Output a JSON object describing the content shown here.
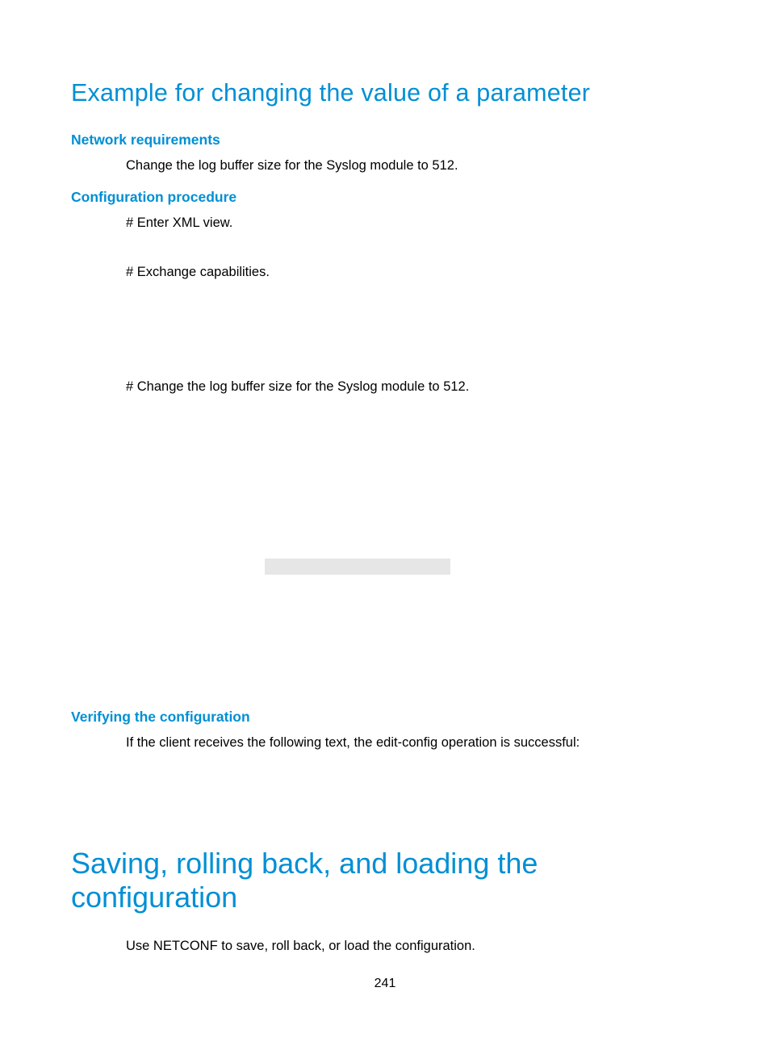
{
  "page_number": "241",
  "section1": {
    "title": "Example for changing the value of a parameter",
    "sub1": {
      "heading": "Network requirements",
      "text": "Change the log buffer size for the Syslog module to 512."
    },
    "sub2": {
      "heading": "Configuration procedure",
      "step1": "# Enter XML view.",
      "step2": "# Exchange capabilities.",
      "step3": "# Change the log buffer size for the Syslog module to 512."
    },
    "sub3": {
      "heading": "Verifying the configuration",
      "text": "If the client receives the following text, the edit-config operation is successful:"
    }
  },
  "section2": {
    "title": "Saving, rolling back, and loading the configuration",
    "text": "Use NETCONF to save, roll back, or load the configuration."
  }
}
